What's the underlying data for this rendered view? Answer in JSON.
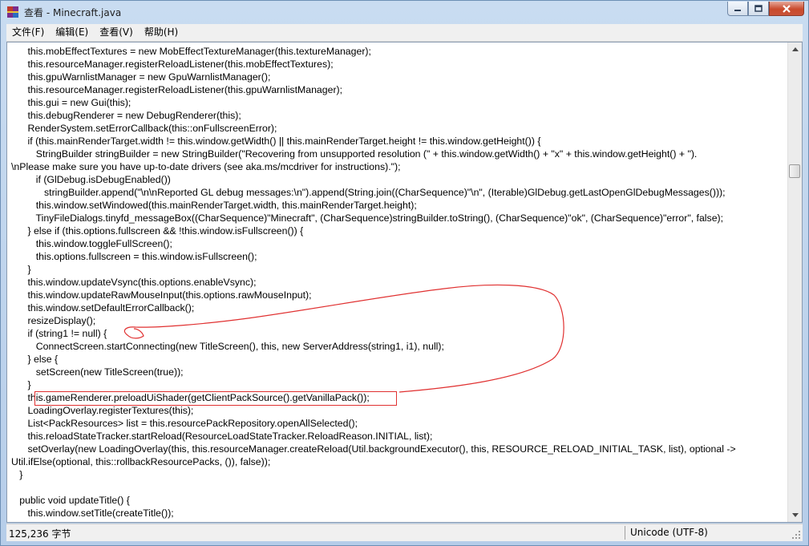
{
  "window": {
    "title": "查看 - Minecraft.java",
    "buttons": {
      "minimize": "minimize",
      "maximize": "maximize",
      "close": "close"
    }
  },
  "menu": [
    {
      "label": "文件(F)"
    },
    {
      "label": "编辑(E)"
    },
    {
      "label": "查看(V)"
    },
    {
      "label": "帮助(H)"
    }
  ],
  "code_lines": [
    "      this.mobEffectTextures = new MobEffectTextureManager(this.textureManager);",
    "      this.resourceManager.registerReloadListener(this.mobEffectTextures);",
    "      this.gpuWarnlistManager = new GpuWarnlistManager();",
    "      this.resourceManager.registerReloadListener(this.gpuWarnlistManager);",
    "      this.gui = new Gui(this);",
    "      this.debugRenderer = new DebugRenderer(this);",
    "      RenderSystem.setErrorCallback(this::onFullscreenError);",
    "      if (this.mainRenderTarget.width != this.window.getWidth() || this.mainRenderTarget.height != this.window.getHeight()) {",
    "         StringBuilder stringBuilder = new StringBuilder(\"Recovering from unsupported resolution (\" + this.window.getWidth() + \"x\" + this.window.getHeight() + \").",
    "\\nPlease make sure you have up-to-date drivers (see aka.ms/mcdriver for instructions).\");",
    "         if (GlDebug.isDebugEnabled())",
    "            stringBuilder.append(\"\\n\\nReported GL debug messages:\\n\").append(String.join((CharSequence)\"\\n\", (Iterable)GlDebug.getLastOpenGlDebugMessages()));",
    "         this.window.setWindowed(this.mainRenderTarget.width, this.mainRenderTarget.height);",
    "         TinyFileDialogs.tinyfd_messageBox((CharSequence)\"Minecraft\", (CharSequence)stringBuilder.toString(), (CharSequence)\"ok\", (CharSequence)\"error\", false);",
    "      } else if (this.options.fullscreen && !this.window.isFullscreen()) {",
    "         this.window.toggleFullScreen();",
    "         this.options.fullscreen = this.window.isFullscreen();",
    "      }",
    "      this.window.updateVsync(this.options.enableVsync);",
    "      this.window.updateRawMouseInput(this.options.rawMouseInput);",
    "      this.window.setDefaultErrorCallback();",
    "      resizeDisplay();",
    "      if (string1 != null) {",
    "         ConnectScreen.startConnecting(new TitleScreen(), this, new ServerAddress(string1, i1), null);",
    "      } else {",
    "         setScreen(new TitleScreen(true));",
    "      }",
    "      this.gameRenderer.preloadUiShader(getClientPackSource().getVanillaPack());",
    "      LoadingOverlay.registerTextures(this);",
    "      List<PackResources> list = this.resourcePackRepository.openAllSelected();",
    "      this.reloadStateTracker.startReload(ResourceLoadStateTracker.ReloadReason.INITIAL, list);",
    "      setOverlay(new LoadingOverlay(this, this.resourceManager.createReload(Util.backgroundExecutor(), this, RESOURCE_RELOAD_INITIAL_TASK, list), optional ->",
    "Util.ifElse(optional, this::rollbackResourcePacks, ()), false));",
    "   }",
    "",
    "   public void updateTitle() {",
    "      this.window.setTitle(createTitle());"
  ],
  "status": {
    "size": "125,236 字节",
    "encoding": "Unicode (UTF-8)"
  },
  "colors": {
    "annotation": "#e03030",
    "titlebar": "#c9dcf1"
  },
  "icons": {
    "app": "winrar-viewer-icon",
    "scroll_up": "arrow-up-icon",
    "scroll_down": "arrow-down-icon"
  }
}
